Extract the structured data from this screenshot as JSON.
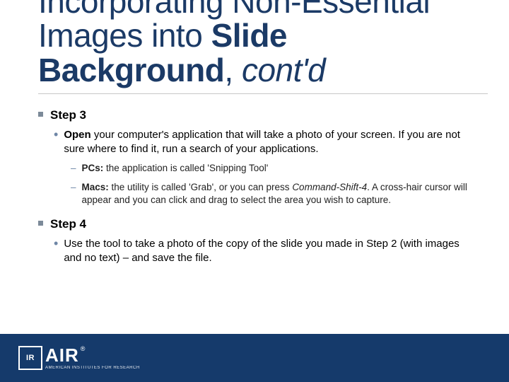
{
  "title": {
    "line1a": "Incorporating Non-Essential",
    "line2a": "Images into ",
    "line2b_bold": "Slide",
    "line3a_bold": "Background",
    "line3b": ", ",
    "line3c_italic": "cont'd"
  },
  "steps": {
    "step3": {
      "label": "Step 3",
      "bullet_open": "Open",
      "bullet_rest": " your computer's application that will take a photo of your screen. If you are not sure where to find it, run a search of your applications.",
      "pc_label": "PCs:",
      "pc_text": " the application is called 'Snipping Tool'",
      "mac_label": "Macs:",
      "mac_text1": " the utility is called 'Grab', or you can press ",
      "mac_cmd": "Command-Shift-4",
      "mac_text2": ". A cross-hair cursor will appear and you can click and drag to select the area you wish to capture."
    },
    "step4": {
      "label": "Step 4",
      "bullet": "Use the tool to take a photo of the copy of the slide you made in Step 2 (with images and no text) – and save the file."
    }
  },
  "footer": {
    "mark": "IR",
    "brand": "AIR",
    "reg": "®",
    "sub": "AMERICAN INSTITUTES FOR RESEARCH"
  }
}
